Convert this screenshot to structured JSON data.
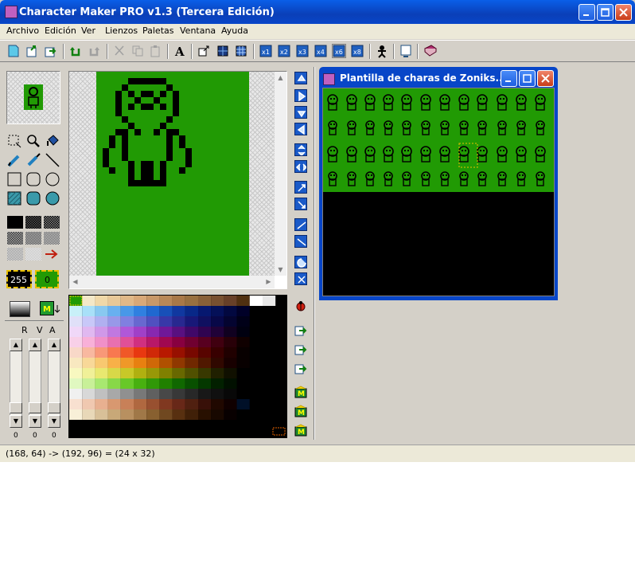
{
  "window": {
    "title": "Character Maker PRO v1.3 (Tercera Edición)"
  },
  "menu": [
    "Archivo",
    "Edición",
    "Ver",
    "Lienzos",
    "Paletas",
    "Ventana",
    "Ayuda"
  ],
  "left_panel": {
    "color_values": {
      "left": "255",
      "right": "0"
    },
    "slider_labels": [
      "R",
      "V",
      "A"
    ],
    "slider_values": [
      "0",
      "0",
      "0"
    ]
  },
  "child_window": {
    "title": "Plantilla de charas de Zoniks..."
  },
  "status": {
    "text": "(168, 64) -> (192, 96) = (24 x 32)"
  },
  "colors": {
    "canvas_green": "#219a04",
    "title_blue": "#0a4fd8",
    "app_gray": "#d4d0c8",
    "selection_yellow": "#e8c000"
  }
}
